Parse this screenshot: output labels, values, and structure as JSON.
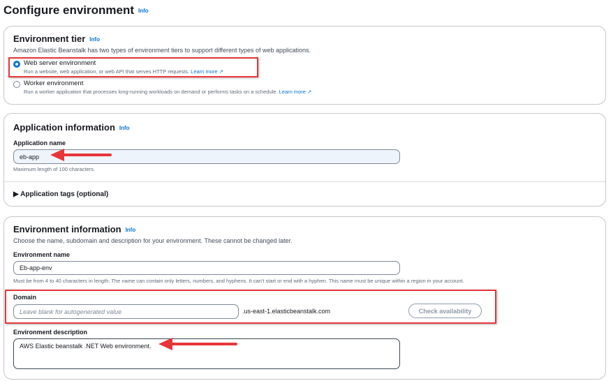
{
  "page": {
    "title": "Configure environment",
    "info": "Info"
  },
  "tier": {
    "title": "Environment tier",
    "info": "Info",
    "description": "Amazon Elastic Beanstalk has two types of environment tiers to support different types of web applications.",
    "options": [
      {
        "label": "Web server environment",
        "description": "Run a website, web application, or web API that serves HTTP requests.",
        "link": "Learn more",
        "selected": true
      },
      {
        "label": "Worker environment",
        "description": "Run a worker application that processes long-running workloads on demand or performs tasks on a schedule.",
        "link": "Learn more",
        "selected": false
      }
    ]
  },
  "app": {
    "title": "Application information",
    "info": "Info",
    "name_label": "Application name",
    "name_value": "eb-app",
    "name_hint": "Maximum length of 100 characters.",
    "tags_label": "Application tags (optional)"
  },
  "env": {
    "title": "Environment information",
    "info": "Info",
    "description": "Choose the name, subdomain and description for your environment. These cannot be changed later.",
    "name_label": "Environment name",
    "name_value": "Eb-app-env",
    "name_hint": "Must be from 4 to 40 characters in length. The name can contain only letters, numbers, and hyphens. It can't start or end with a hyphen. This name must be unique within a region in your account.",
    "domain_label": "Domain",
    "domain_placeholder": "Leave blank for autogenerated value",
    "domain_suffix": ".us-east-1.elasticbeanstalk.com",
    "check_button": "Check availability",
    "desc_label": "Environment description",
    "desc_value": "AWS Elastic beanstalk .NET Web environment."
  },
  "colors": {
    "accent": "#0972d3",
    "annotation": "#e8353a"
  }
}
